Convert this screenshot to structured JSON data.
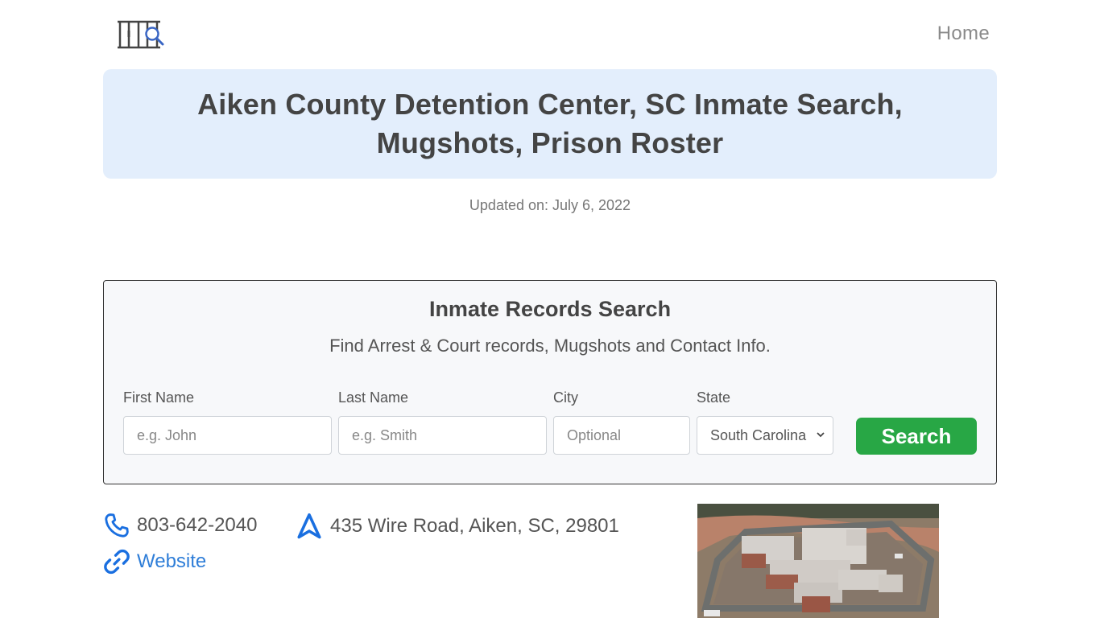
{
  "header": {
    "logo_icon": "jail-bars-search-icon",
    "nav": {
      "home_label": "Home"
    }
  },
  "hero": {
    "title_line1": "Aiken County Detention Center, SC Inmate Search,",
    "title_line2": "Mugshots, Prison Roster"
  },
  "updated": "Updated on: July 6, 2022",
  "search": {
    "title": "Inmate Records Search",
    "subtitle": "Find Arrest & Court records, Mugshots and Contact Info.",
    "fields": {
      "first_name": {
        "label": "First Name",
        "placeholder": "e.g. John",
        "value": ""
      },
      "last_name": {
        "label": "Last Name",
        "placeholder": "e.g. Smith",
        "value": ""
      },
      "city": {
        "label": "City",
        "placeholder": "Optional",
        "value": ""
      },
      "state": {
        "label": "State",
        "selected": "South Carolina"
      }
    },
    "button_label": "Search",
    "button_color": "#28a745"
  },
  "contact": {
    "phone": "803-642-2040",
    "phone_icon": "phone-icon",
    "address": "435 Wire Road, Aiken, SC, 29801",
    "address_icon": "navigation-arrow-icon",
    "website_label": "Website",
    "website_icon": "link-icon",
    "accent_color": "#1a6fe0"
  },
  "facility_image": {
    "alt": "Aerial view of Aiken County Detention Center"
  }
}
